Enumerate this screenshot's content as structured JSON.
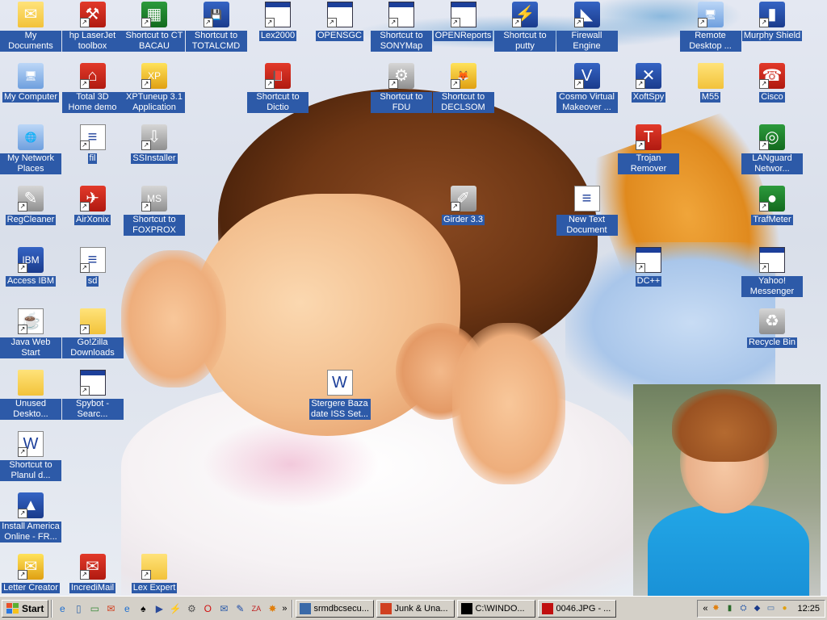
{
  "desktop": {
    "icons": [
      {
        "label": "My Documents",
        "glyph": "folder-docs-icon",
        "shortcut": false
      },
      {
        "label": "hp LaserJet toolbox",
        "glyph": "toolbox-icon",
        "shortcut": true
      },
      {
        "label": "Shortcut to CT BACAU",
        "glyph": "excel-doc-icon",
        "shortcut": true
      },
      {
        "label": "Shortcut to TOTALCMD",
        "glyph": "floppy-icon",
        "shortcut": true
      },
      {
        "label": "Lex2000",
        "glyph": "app-window-icon",
        "shortcut": true
      },
      {
        "label": "OPENSGC",
        "glyph": "app-window-icon",
        "shortcut": true
      },
      {
        "label": "Shortcut to SONYMap",
        "glyph": "app-window-icon",
        "shortcut": true
      },
      {
        "label": "OPENReports",
        "glyph": "app-window-icon",
        "shortcut": true
      },
      {
        "label": "Shortcut to putty",
        "glyph": "putty-icon",
        "shortcut": true
      },
      {
        "label": "Firewall Engine",
        "glyph": "shield-icon",
        "shortcut": true
      },
      {
        "label": "Remote Desktop ...",
        "glyph": "remote-desktop-icon",
        "shortcut": true
      },
      {
        "label": "Murphy Shield",
        "glyph": "murphy-icon",
        "shortcut": true
      },
      {
        "label": "My Computer",
        "glyph": "computer-icon",
        "shortcut": false
      },
      {
        "label": "Total 3D Home demo",
        "glyph": "house-3d-icon",
        "shortcut": true
      },
      {
        "label": "XPTuneup 3.1 Application",
        "glyph": "xptuneup-icon",
        "shortcut": true
      },
      {
        "label": "Shortcut to Dictio",
        "glyph": "book-icon",
        "shortcut": true
      },
      {
        "label": "Shortcut to FDU",
        "glyph": "tools-icon",
        "shortcut": true
      },
      {
        "label": "Shortcut to DECLSOM",
        "glyph": "fox-icon",
        "shortcut": true
      },
      {
        "label": "Cosmo Virtual Makeover ...",
        "glyph": "cosmo-icon",
        "shortcut": true
      },
      {
        "label": "XoftSpy",
        "glyph": "xoftspy-icon",
        "shortcut": true
      },
      {
        "label": "M55",
        "glyph": "folder-icon",
        "shortcut": false
      },
      {
        "label": "Cisco",
        "glyph": "phone-icon",
        "shortcut": true
      },
      {
        "label": "My Network Places",
        "glyph": "network-icon",
        "shortcut": false
      },
      {
        "label": "fil",
        "glyph": "notepad-icon",
        "shortcut": true
      },
      {
        "label": "SSInstaller",
        "glyph": "installer-icon",
        "shortcut": true
      },
      {
        "label": "Trojan Remover",
        "glyph": "trojan-icon",
        "shortcut": true
      },
      {
        "label": "LANguard Networ...",
        "glyph": "radar-icon",
        "shortcut": true
      },
      {
        "label": "RegCleaner",
        "glyph": "regcleaner-icon",
        "shortcut": true
      },
      {
        "label": "AirXonix",
        "glyph": "airxonix-icon",
        "shortcut": true
      },
      {
        "label": "Shortcut to FOXPROX",
        "glyph": "foxpro-icon",
        "shortcut": true
      },
      {
        "label": "Girder 3.3",
        "glyph": "remote-control-icon",
        "shortcut": true
      },
      {
        "label": "New Text Document",
        "glyph": "text-doc-icon",
        "shortcut": false
      },
      {
        "label": "TrafMeter",
        "glyph": "traffic-light-icon",
        "shortcut": true
      },
      {
        "label": "Access IBM",
        "glyph": "ibm-icon",
        "shortcut": true
      },
      {
        "label": "sd",
        "glyph": "notepad-icon",
        "shortcut": true
      },
      {
        "label": "DC++",
        "glyph": "app-window-icon",
        "shortcut": true
      },
      {
        "label": "Yahoo! Messenger",
        "glyph": "app-window-icon",
        "shortcut": true
      },
      {
        "label": "Java Web Start",
        "glyph": "java-icon",
        "shortcut": true
      },
      {
        "label": "Go!Zilla Downloads",
        "glyph": "folder-icon",
        "shortcut": true
      },
      {
        "label": "Recycle Bin",
        "glyph": "recycle-bin-icon",
        "shortcut": false
      },
      {
        "label": "Stergere Baza date ISS Set...",
        "glyph": "word-doc-icon",
        "shortcut": false
      },
      {
        "label": "Unused Deskto...",
        "glyph": "folder-icon",
        "shortcut": false
      },
      {
        "label": "Spybot - Searc...",
        "glyph": "spybot-icon",
        "shortcut": true
      },
      {
        "label": "Shortcut to Planul d...",
        "glyph": "word-doc-icon",
        "shortcut": true
      },
      {
        "label": "Install America Online - FR...",
        "glyph": "aol-icon",
        "shortcut": true
      },
      {
        "label": "Letter Creator",
        "glyph": "letter-creator-icon",
        "shortcut": true
      },
      {
        "label": "IncrediMail",
        "glyph": "mail-icon",
        "shortcut": true
      },
      {
        "label": "Lex Expert",
        "glyph": "folder-icon",
        "shortcut": true
      }
    ]
  },
  "taskbar": {
    "start_label": "Start",
    "quick_launch": [
      "ie-quicklaunch-icon",
      "notepad-quicklaunch-icon",
      "desktop-quicklaunch-icon",
      "incredimail-quicklaunch-icon",
      "ie2-quicklaunch-icon",
      "solitaire-quicklaunch-icon",
      "media-quicklaunch-icon",
      "winamp-quicklaunch-icon",
      "gear-quicklaunch-icon",
      "opera-quicklaunch-icon",
      "outlook-quicklaunch-icon",
      "paint-quicklaunch-icon",
      "zonealarm-quicklaunch-icon",
      "burst-quicklaunch-icon"
    ],
    "chevron": "»",
    "tasks": [
      {
        "label": "srmdbcsecu...",
        "icon": "network-task-icon"
      },
      {
        "label": "Junk & Una...",
        "icon": "mail-task-icon"
      },
      {
        "label": "C:\\WINDO...",
        "icon": "cmd-task-icon"
      },
      {
        "label": "0046.JPG - ...",
        "icon": "image-viewer-task-icon"
      }
    ],
    "tray": {
      "chevron": "«",
      "icons": [
        "burst-tray-icon",
        "meter-tray-icon",
        "network-tray-icon",
        "shield-tray-icon",
        "monitor-tray-icon",
        "zonealarm-tray-icon"
      ],
      "clock": "12:25"
    }
  }
}
